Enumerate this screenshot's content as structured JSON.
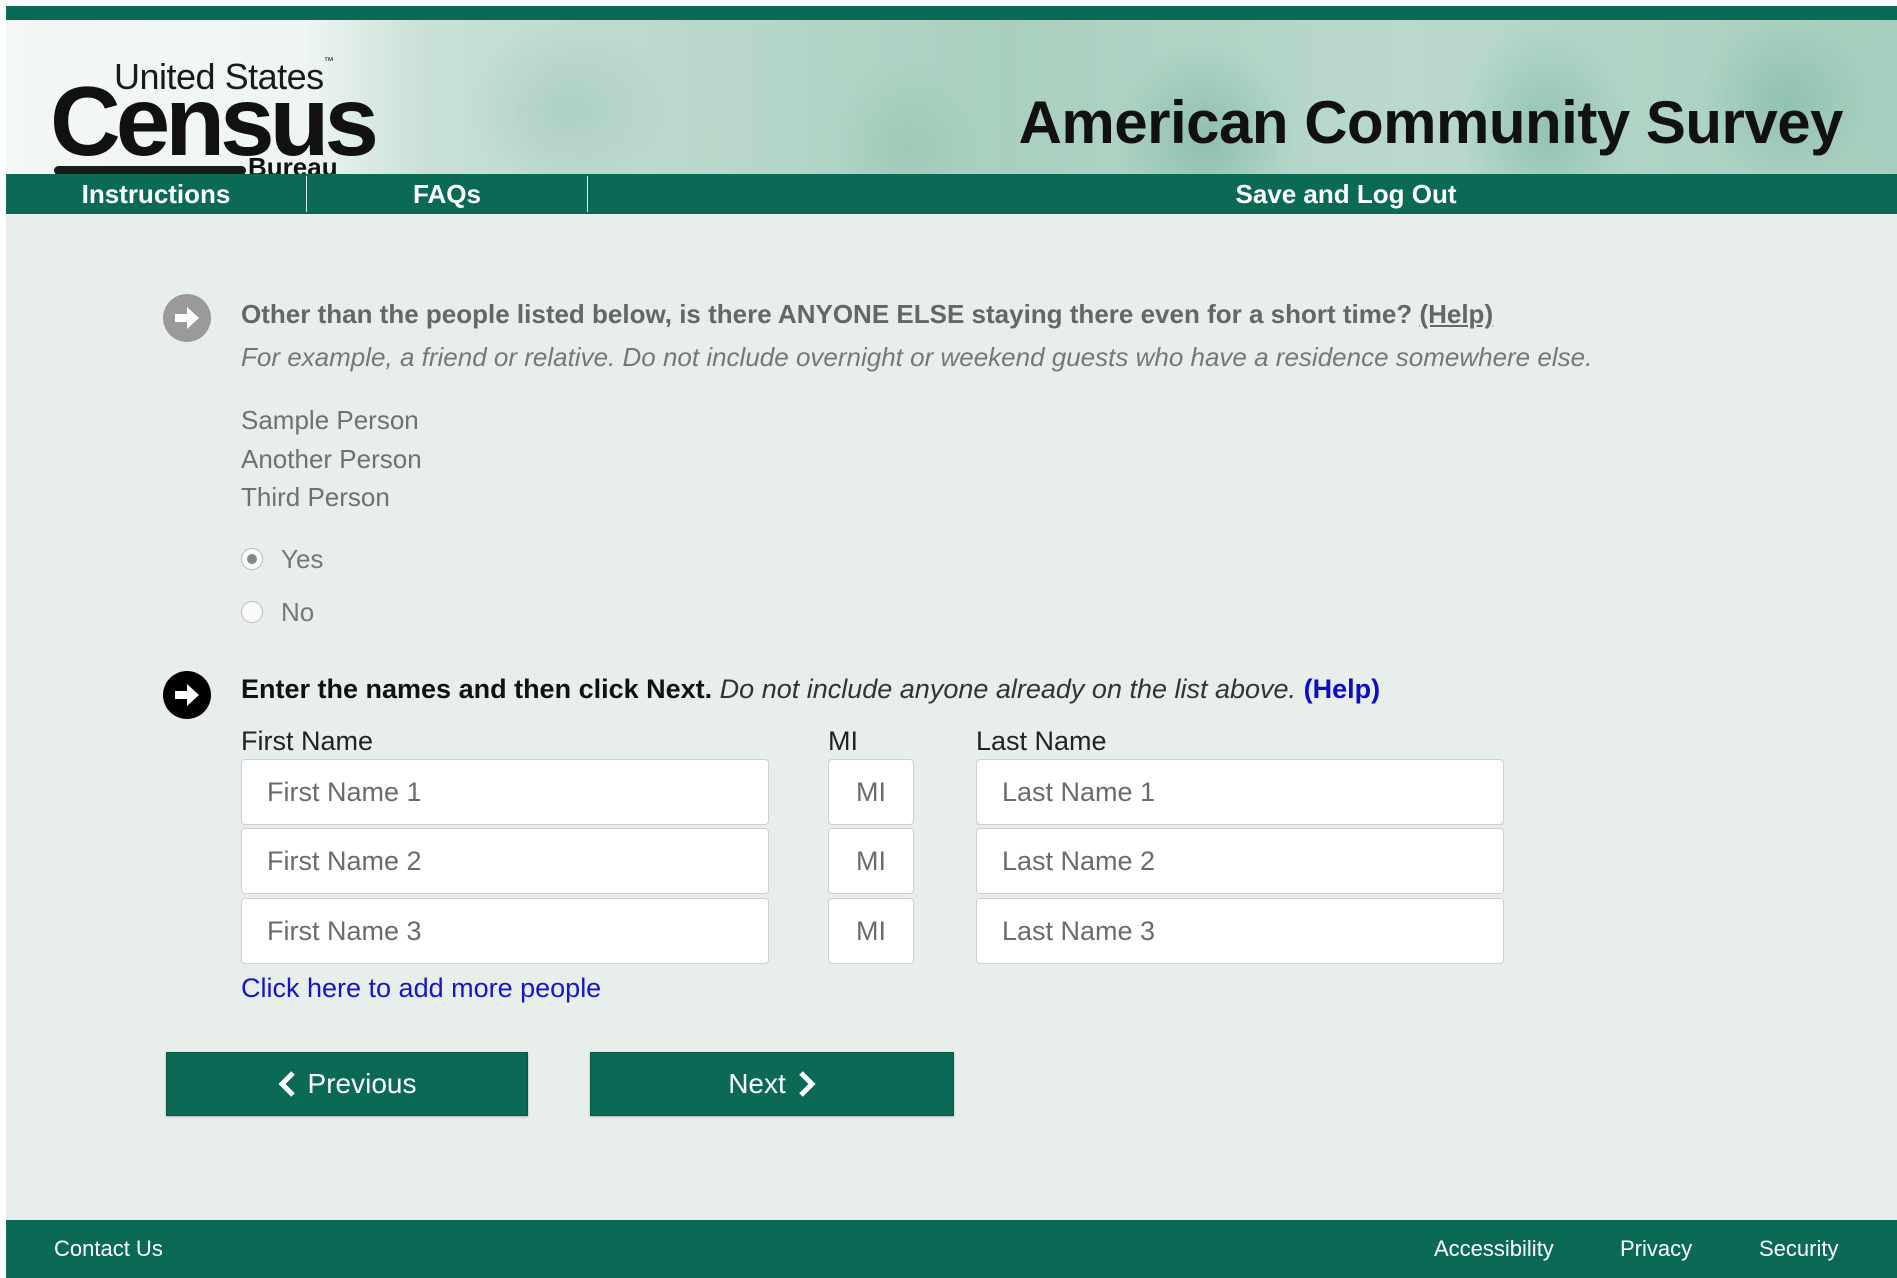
{
  "header": {
    "logo": {
      "line1": "United States",
      "tm": "™",
      "line2": "Census",
      "line3": "Bureau"
    },
    "survey_title": "American Community Survey",
    "nav": {
      "instructions": "Instructions",
      "faqs": "FAQs",
      "save_logout": "Save and Log Out"
    }
  },
  "question1": {
    "text": "Other than the people listed below, is there ANYONE ELSE staying there even for a short time?",
    "help": "(Help)",
    "subtext": "For example, a friend or relative. Do not include overnight or weekend guests who have a residence somewhere else.",
    "people": [
      "Sample Person",
      "Another Person",
      "Third Person"
    ],
    "options": [
      {
        "label": "Yes",
        "selected": true
      },
      {
        "label": "No",
        "selected": false
      }
    ]
  },
  "question2": {
    "bold": "Enter the names and then click Next.",
    "italic": "Do not include anyone already on the list above.",
    "help": "(Help)",
    "columns": {
      "first": "First Name",
      "mi": "MI",
      "last": "Last Name"
    },
    "rows": [
      {
        "first_placeholder": "First Name 1",
        "mi_placeholder": "MI",
        "last_placeholder": "Last Name 1"
      },
      {
        "first_placeholder": "First Name 2",
        "mi_placeholder": "MI",
        "last_placeholder": "Last Name 2"
      },
      {
        "first_placeholder": "First Name 3",
        "mi_placeholder": "MI",
        "last_placeholder": "Last Name 3"
      }
    ],
    "add_more": "Click here to add more people"
  },
  "buttons": {
    "previous": "Previous",
    "next": "Next"
  },
  "footer": {
    "contact": "Contact Us",
    "accessibility": "Accessibility",
    "privacy": "Privacy",
    "security": "Security"
  },
  "colors": {
    "brand_green": "#0b6a56",
    "link_blue": "#1515cc",
    "background": "#e7eeeb"
  }
}
